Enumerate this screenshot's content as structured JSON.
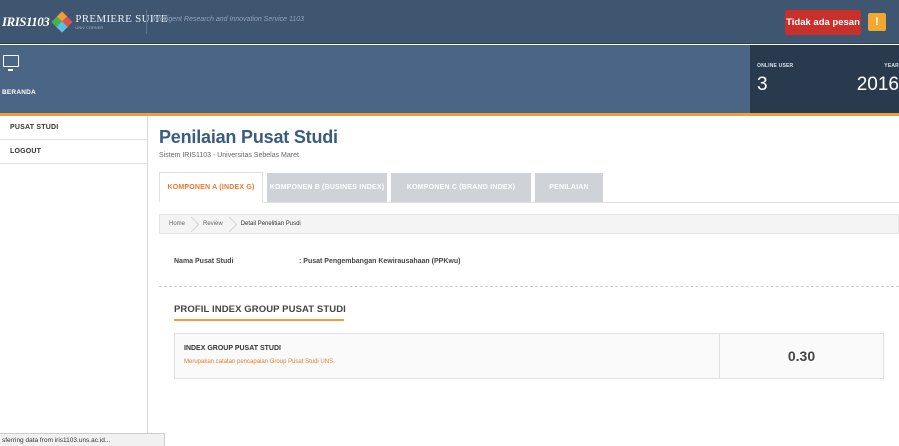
{
  "header": {
    "logo_text": "IRIS1103",
    "logo_suite": "PREMIERE SUITE",
    "logo_sub": "UNIV CORNER",
    "tagline": "Intelligent Research and Innovation Service 1103",
    "message_button": "Tidak ada pesan",
    "warning_icon": "!"
  },
  "navbar": {
    "home_label": "BERANDA",
    "online_user_label": "ONLINE USER",
    "online_user_value": "3",
    "year_label": "YEAR",
    "year_value": "2016"
  },
  "sidebar": {
    "items": [
      {
        "label": "PUSAT STUDI"
      },
      {
        "label": "LOGOUT"
      }
    ]
  },
  "main": {
    "title": "Penilaian Pusat Studi",
    "subtitle": "Sistem IRIS1103 - Universitas Sebelas Maret",
    "tabs": [
      {
        "label": "KOMPONEN A (INDEX G)"
      },
      {
        "label": "KOMPONEN B (BUSINES INDEX)"
      },
      {
        "label": "KOMPONEN C (BRAND INDEX)"
      },
      {
        "label": "PENILAIAN"
      }
    ],
    "breadcrumb": [
      {
        "label": "Home"
      },
      {
        "label": "Review"
      },
      {
        "label": "Detail Penelitian Pusdi"
      }
    ],
    "info_label": "Nama Pusat Studi",
    "info_value": ": Pusat Pengembangan Kewirausahaan (PPKwu)",
    "section_title": "PROFIL INDEX GROUP PUSAT STUDI",
    "card": {
      "title": "INDEX GROUP PUSAT STUDI",
      "description": "Merupakan catatan pencapaian Group Pusat Studi UNS.",
      "score": "0.30"
    }
  },
  "statusbar": {
    "text": "sferring data from iris1103.uns.ac.id..."
  },
  "colors": {
    "topbar": "#3f5670",
    "navbar": "#4a6585",
    "stats_bg": "#2a3a4e",
    "accent_orange": "#f39c3a",
    "active_tab_text": "#e8792a",
    "message_button": "#c9302c",
    "title_blue": "#3a5c7e"
  }
}
